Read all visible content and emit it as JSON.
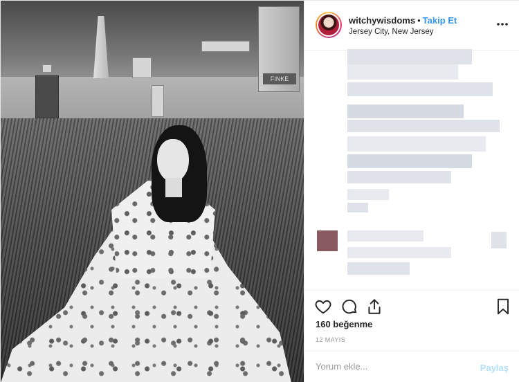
{
  "header": {
    "username": "witchywisdoms",
    "separator": "•",
    "follow_label": "Takip Et",
    "location": "Jersey City, New Jersey",
    "more_icon": "more-horizontal-icon"
  },
  "photo": {
    "tomb_inscription": "FINKE"
  },
  "actions": {
    "icons": [
      "heart-icon",
      "comment-icon",
      "share-icon",
      "bookmark-icon"
    ],
    "likes": "160 beğenme",
    "date": "12 MAYIS"
  },
  "comment_bar": {
    "placeholder": "Yorum ekle...",
    "post_label": "Paylaş"
  },
  "colors": {
    "link_blue": "#3897f0",
    "post_disabled": "#b2dffc",
    "border": "#efefef"
  }
}
